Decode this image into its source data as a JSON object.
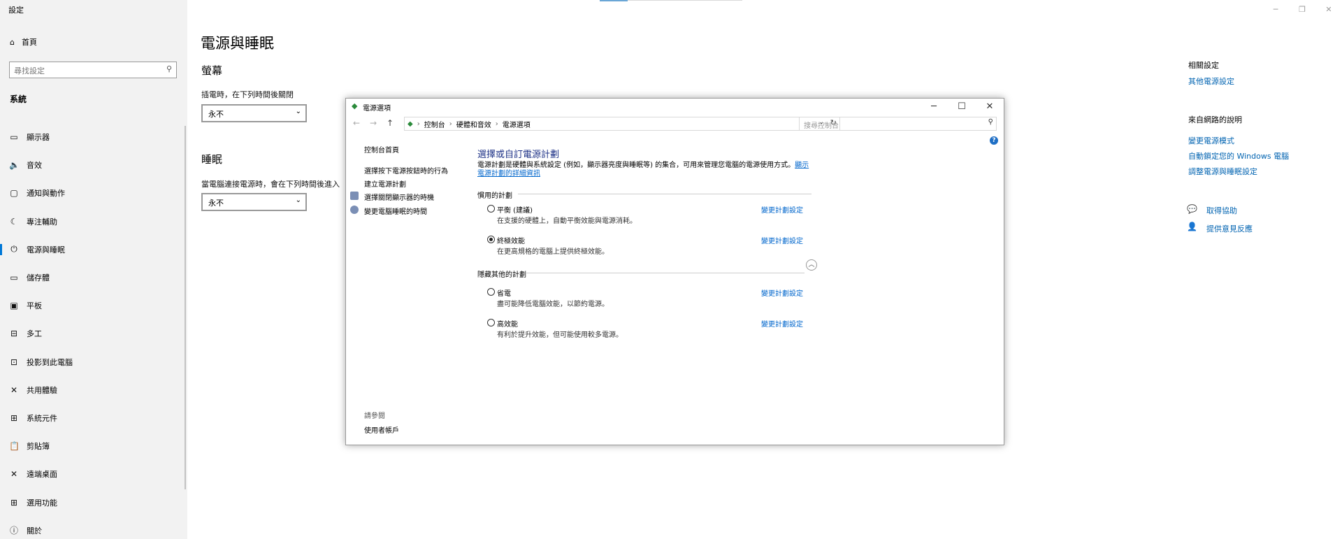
{
  "window": {
    "title": "設定"
  },
  "sidebar": {
    "home": "首頁",
    "search_placeholder": "尋找設定",
    "section": "系統",
    "items": [
      {
        "label": "顯示器",
        "icon": "monitor-icon",
        "glyph": "▭"
      },
      {
        "label": "音效",
        "icon": "speaker-icon",
        "glyph": "🔈"
      },
      {
        "label": "通知與動作",
        "icon": "notification-icon",
        "glyph": "▢"
      },
      {
        "label": "專注輔助",
        "icon": "moon-icon",
        "glyph": "☾"
      },
      {
        "label": "電源與睡眠",
        "icon": "power-icon",
        "glyph": "⏻"
      },
      {
        "label": "儲存體",
        "icon": "storage-icon",
        "glyph": "▭"
      },
      {
        "label": "平板",
        "icon": "tablet-icon",
        "glyph": "▣"
      },
      {
        "label": "多工",
        "icon": "multitask-icon",
        "glyph": "⊟"
      },
      {
        "label": "投影到此電腦",
        "icon": "project-icon",
        "glyph": "⊡"
      },
      {
        "label": "共用體驗",
        "icon": "share-icon",
        "glyph": "✕"
      },
      {
        "label": "系統元件",
        "icon": "components-icon",
        "glyph": "⊞"
      },
      {
        "label": "剪貼簿",
        "icon": "clipboard-icon",
        "glyph": "📋"
      },
      {
        "label": "遠端桌面",
        "icon": "remote-icon",
        "glyph": "✕"
      },
      {
        "label": "選用功能",
        "icon": "features-icon",
        "glyph": "⊞"
      },
      {
        "label": "關於",
        "icon": "info-icon",
        "glyph": "ⓘ"
      }
    ]
  },
  "main": {
    "title": "電源與睡眠",
    "screen_heading": "螢幕",
    "screen_label": "插電時，在下列時間後關閉",
    "screen_value": "永不",
    "sleep_heading": "睡眠",
    "sleep_label": "當電腦連接電源時，會在下列時間後進入",
    "sleep_value": "永不"
  },
  "right": {
    "related_heading": "相關設定",
    "related_link": "其他電源設定",
    "help_heading": "來自網路的說明",
    "help_links": [
      "變更電源模式",
      "自動鎖定您的 Windows 電腦",
      "調整電源與睡眠設定"
    ],
    "get_help": "取得協助",
    "feedback": "提供意見反應"
  },
  "dialog": {
    "title": "電源選項",
    "breadcrumb": [
      "控制台",
      "硬體和音效",
      "電源選項"
    ],
    "search_placeholder": "搜尋控制台",
    "left_nav": [
      "控制台首頁",
      "選擇按下電源按鈕時的行為",
      "建立電源計劃",
      "選擇關閉顯示器的時機",
      "變更電腦睡眠的時間"
    ],
    "see_also": "請參閱",
    "user_accounts": "使用者帳戶",
    "heading": "選擇或自訂電源計劃",
    "desc_text": "電源計劃是硬體與系統設定 (例如，顯示器亮度與睡眠等) 的集合，可用來管理您電腦的電源使用方式。",
    "desc_link": "顯示電源計劃的詳細資訊",
    "preferred_heading": "慣用的計劃",
    "hidden_heading": "隱藏其他的計劃",
    "change_link": "變更計劃設定",
    "plans": [
      {
        "name": "平衡 (建議)",
        "desc": "在支援的硬體上，自動平衡效能與電源消耗。",
        "selected": false
      },
      {
        "name": "終極效能",
        "desc": "在更高規格的電腦上提供終極效能。",
        "selected": true
      },
      {
        "name": "省電",
        "desc": "盡可能降低電腦效能，以節約電源。",
        "selected": false
      },
      {
        "name": "高效能",
        "desc": "有利於提升效能，但可能使用較多電源。",
        "selected": false
      }
    ]
  }
}
